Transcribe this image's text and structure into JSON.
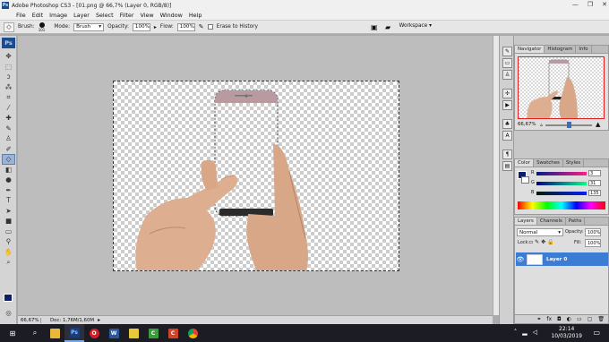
{
  "titlebar": {
    "app_icon": "Ps",
    "title": "Adobe Photoshop CS3 - [01.png @ 66,7% (Layer 0, RGB/8)]",
    "controls": [
      "—",
      "❐",
      "✕"
    ]
  },
  "menu": [
    "File",
    "Edit",
    "Image",
    "Layer",
    "Select",
    "Filter",
    "View",
    "Window",
    "Help"
  ],
  "options": {
    "brush_label": "Brush:",
    "brush_size": "101",
    "mode_label": "Mode:",
    "mode_value": "Brush",
    "opacity_label": "Opacity:",
    "opacity_value": "100%",
    "flow_label": "Flow:",
    "flow_value": "100%",
    "erase_history_label": "Erase to History",
    "workspace_label": "Workspace ▾"
  },
  "toolbox": {
    "logo": "Ps",
    "tools": [
      "move-tool",
      "marquee-tool",
      "lasso-tool",
      "magic-wand-tool",
      "crop-tool",
      "slice-tool",
      "healing-tool",
      "brush-tool",
      "clone-stamp-tool",
      "history-brush-tool",
      "eraser-tool",
      "gradient-tool",
      "dodge-tool",
      "pen-tool",
      "type-tool",
      "path-select-tool",
      "shape-tool",
      "notes-tool",
      "eyedropper-tool",
      "hand-tool",
      "zoom-tool"
    ],
    "active_tool": "eraser-tool",
    "foreground_color": "#0a1f6b",
    "background_color": "#ffffff"
  },
  "status": {
    "zoom": "66,67%",
    "doc_info": "Doc: 1,76M/1,60M"
  },
  "navigator": {
    "tabs": [
      "Navigator",
      "Histogram",
      "Info"
    ],
    "zoom": "66,67%"
  },
  "color_panel": {
    "tabs": [
      "Color",
      "Swatches",
      "Styles"
    ],
    "r_label": "R",
    "g_label": "G",
    "b_label": "B",
    "r_value": "3",
    "g_value": "31",
    "b_value": "135"
  },
  "layers_panel": {
    "tabs": [
      "Layers",
      "Channels",
      "Paths"
    ],
    "blend_mode": "Normal",
    "opacity_label": "Opacity:",
    "opacity_value": "100%",
    "lock_label": "Lock:",
    "fill_label": "Fill:",
    "fill_value": "100%",
    "layers": [
      {
        "name": "Layer 0",
        "visible": true,
        "selected": true
      }
    ]
  },
  "taskbar": {
    "apps": [
      "search-icon",
      "task-view-icon",
      "file-explorer-icon",
      "photoshop-icon",
      "opera-icon",
      "word-icon",
      "sticky-notes-icon",
      "camtasia-icon",
      "recorder-icon",
      "chrome-icon"
    ],
    "time": "22:14",
    "date": "10/03/2019"
  }
}
